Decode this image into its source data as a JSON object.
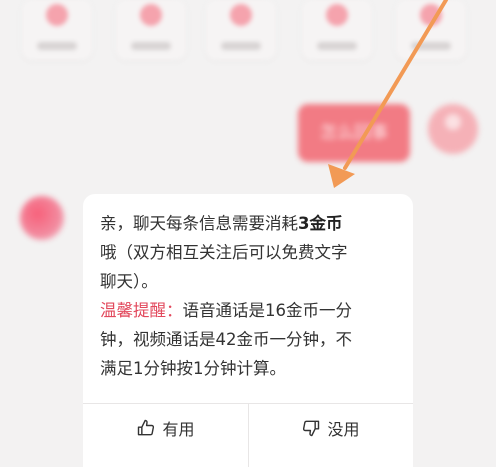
{
  "chat": {
    "outgoing_text": "怎么回事",
    "incoming": {
      "line1_prefix": "亲，聊天每条信息需要消耗",
      "line1_cost": "3金币",
      "line2": "哦（双方相互关注后可以免费文字",
      "line3": "聊天）。",
      "hint_label": "温馨提醒：",
      "hint_text": "语音通话是16金币一分",
      "line5": "钟，视频通话是42金币一分钟，不",
      "line6": "满足1分钟按1分钟计算。"
    },
    "feedback": {
      "useful_label": "有用",
      "useless_label": "没用"
    }
  },
  "colors": {
    "arrow": "#f29a55",
    "hint": "#e2485c",
    "bubble": "#f27b84"
  },
  "icons": {
    "useful": "thumb-up-icon",
    "useless": "thumb-down-icon"
  }
}
